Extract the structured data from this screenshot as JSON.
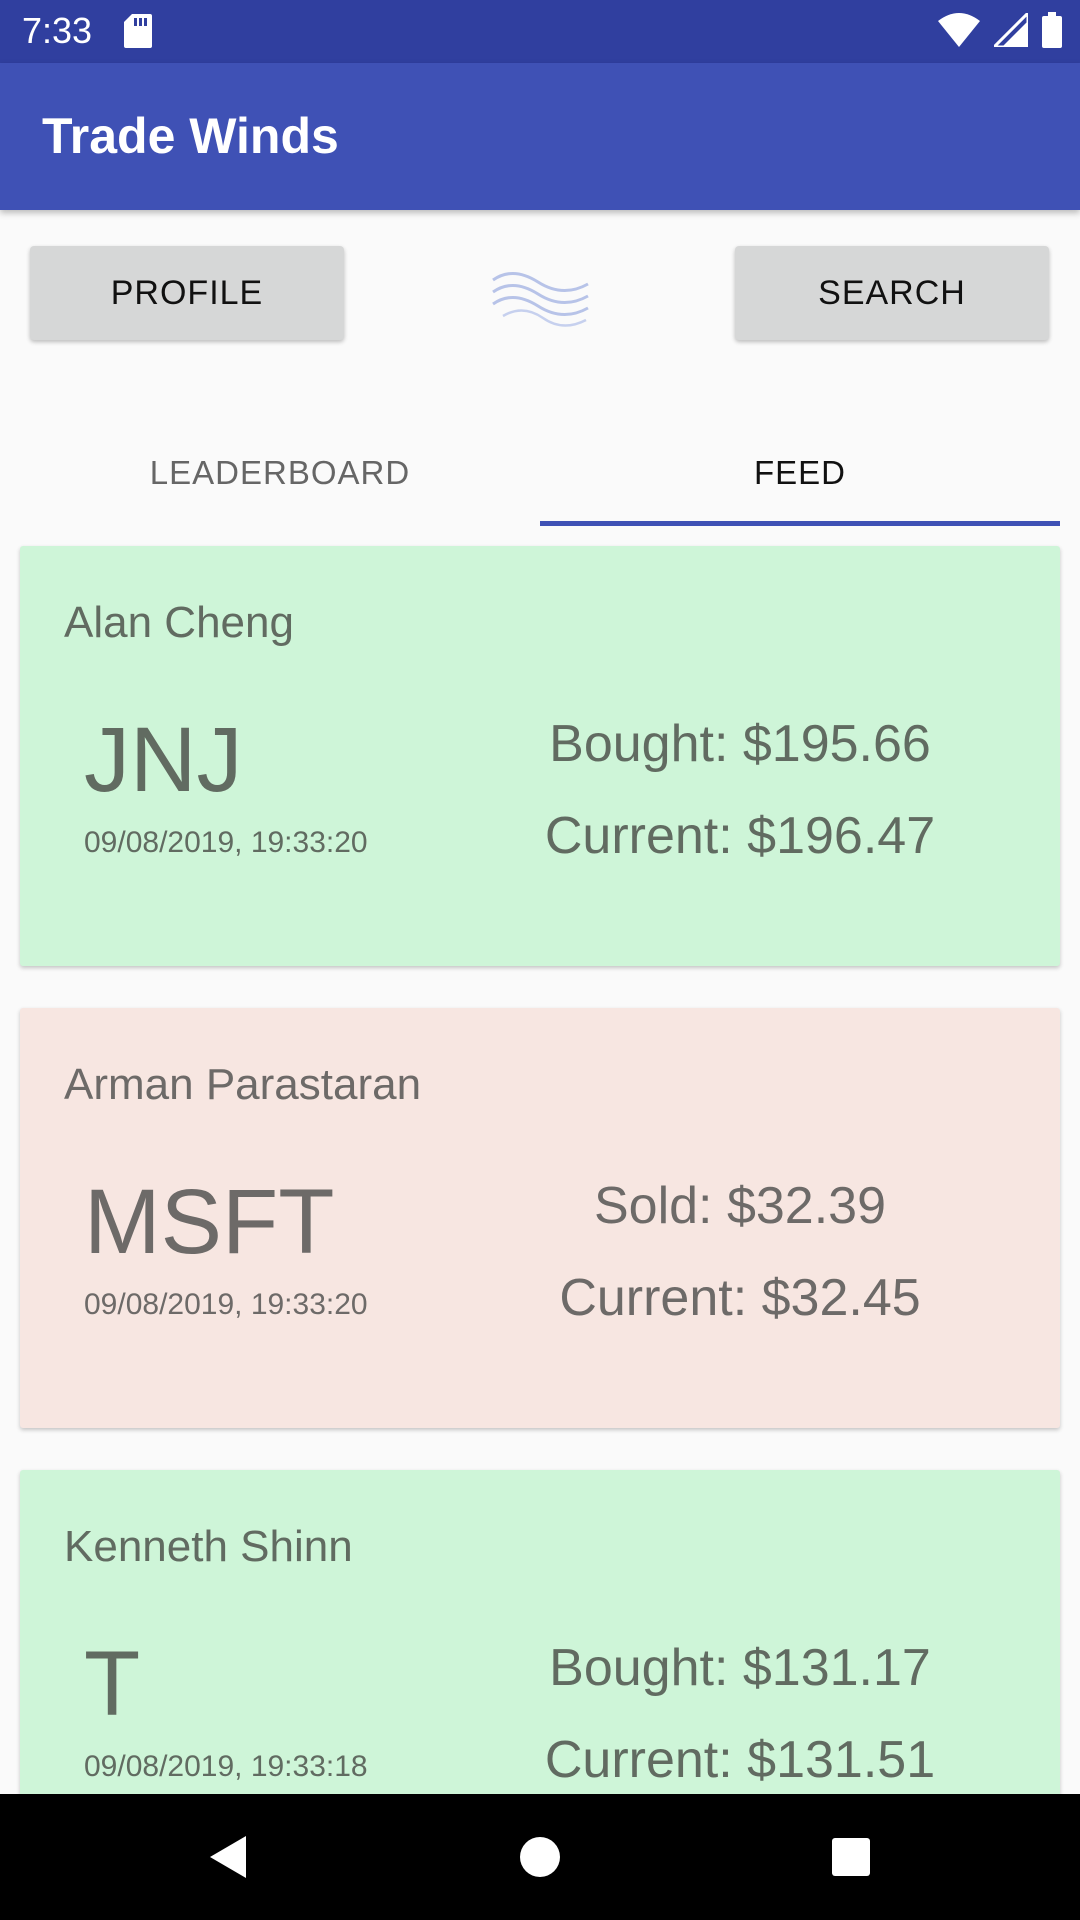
{
  "status_bar": {
    "time": "7:33"
  },
  "app": {
    "title": "Trade Winds"
  },
  "toolbar": {
    "profile_label": "PROFILE",
    "search_label": "SEARCH"
  },
  "tabs": [
    {
      "label": "LEADERBOARD",
      "selected": false
    },
    {
      "label": "FEED",
      "selected": true
    }
  ],
  "feed": [
    {
      "name": "Alan Cheng",
      "ticker": "JNJ",
      "date": "09/08/2019, 19:33:20",
      "trade": "Bought: $195.66",
      "current": "Current: $196.47",
      "status": "gain",
      "color": "#cef5d8"
    },
    {
      "name": "Arman Parastaran",
      "ticker": "MSFT",
      "date": "09/08/2019, 19:33:20",
      "trade": "Sold: $32.39",
      "current": "Current: $32.45",
      "status": "loss",
      "color": "#f7e6e1"
    },
    {
      "name": "Kenneth Shinn",
      "ticker": "T",
      "date": "09/08/2019, 19:33:18",
      "trade": "Bought: $131.17",
      "current": "Current: $131.51",
      "status": "gain",
      "color": "#cef5d8"
    }
  ],
  "colors": {
    "primary": "#3f51b5",
    "primary_dark": "#303f9f"
  },
  "icons": [
    "sd-card-icon",
    "wifi-icon",
    "signal-icon",
    "battery-icon",
    "wind-logo-icon",
    "back-icon",
    "home-icon",
    "recents-icon"
  ]
}
